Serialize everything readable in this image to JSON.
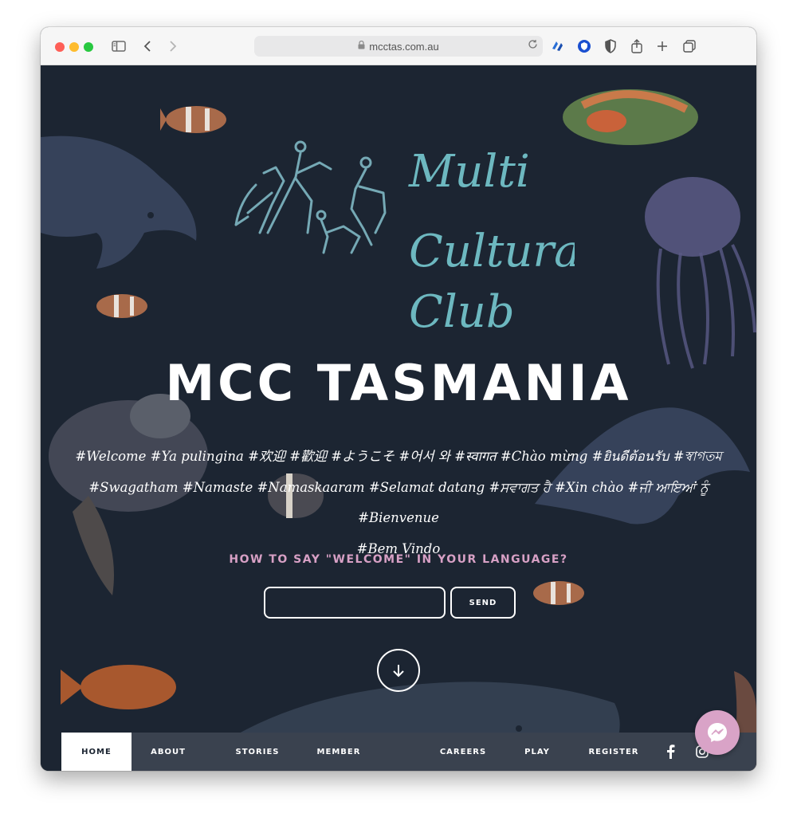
{
  "browser": {
    "url": "mcctas.com.au"
  },
  "logo": {
    "line1": "Multi",
    "line2": "Cultural",
    "line3": "Club"
  },
  "hero": {
    "title": "MCC TASMANIA",
    "greetings_line1": "#Welcome #Ya pulingina #欢迎 #歡迎 #ようこそ #어서 와 #स्वागत #Chào mừng #ยินดีต้อนรับ #স্বাগতম",
    "greetings_line2": "#Swagatham #Namaste #Namaskaaram #Selamat datang #ਸਵਾਗਤ ਹੈ #Xin chào #ਜੀ ਆਇਆਂ ਨੂੰ #Bienvenue",
    "greetings_line3": "#Bem Vindo",
    "question": "HOW TO SAY \"WELCOME\" IN YOUR LANGUAGE?",
    "input_value": "",
    "send_label": "SEND"
  },
  "nav": {
    "items": [
      {
        "label": "HOME",
        "active": true
      },
      {
        "label": "ABOUT"
      },
      {
        "label": "STORIES"
      },
      {
        "label": "MEMBER"
      },
      {
        "label": "CAREERS"
      },
      {
        "label": "PLAY"
      },
      {
        "label": "REGISTER"
      }
    ]
  },
  "icons": {
    "facebook": "facebook-icon",
    "instagram": "instagram-icon",
    "messenger": "messenger-icon",
    "scroll": "arrow-down-icon"
  },
  "colors": {
    "background": "#1c2532",
    "accent_pink": "#d7a0c5",
    "logo_teal": "#6db8c0",
    "nav_bar": "#3a424f"
  }
}
